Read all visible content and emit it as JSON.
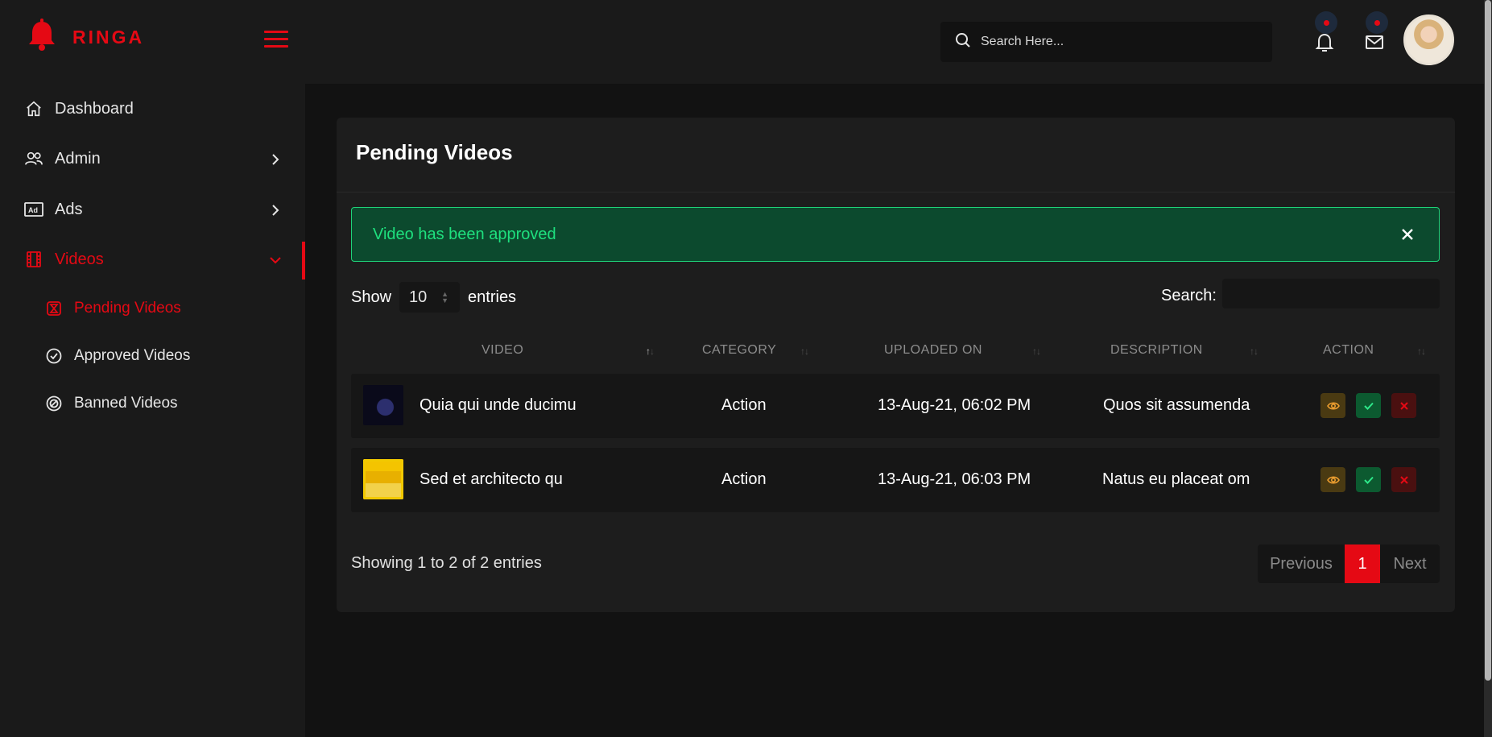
{
  "brand": {
    "name": "RINGA",
    "color": "#e50914"
  },
  "sidebar": {
    "items": [
      {
        "label": "Dashboard",
        "icon": "home-icon"
      },
      {
        "label": "Admin",
        "icon": "users-icon"
      },
      {
        "label": "Ads",
        "icon": "ad-icon"
      },
      {
        "label": "Videos",
        "icon": "film-icon"
      }
    ],
    "sub_items": [
      {
        "label": "Pending Videos",
        "icon": "pending-icon"
      },
      {
        "label": "Approved Videos",
        "icon": "check-circle-icon"
      },
      {
        "label": "Banned Videos",
        "icon": "ban-icon"
      }
    ]
  },
  "header": {
    "search_placeholder": "Search Here..."
  },
  "page": {
    "title": "Pending Videos",
    "alert": "Video has been approved",
    "show_label": "Show",
    "entries_count": "10",
    "entries_label": "entries",
    "search_label": "Search:"
  },
  "table": {
    "headers": [
      "VIDEO",
      "CATEGORY",
      "UPLOADED ON",
      "DESCRIPTION",
      "ACTION"
    ],
    "rows": [
      {
        "title": "Quia qui unde ducimu",
        "category": "Action",
        "uploaded": "13-Aug-21, 06:02 PM",
        "description": "Quos sit assumenda"
      },
      {
        "title": "Sed et architecto qu",
        "category": "Action",
        "uploaded": "13-Aug-21, 06:03 PM",
        "description": "Natus eu placeat om"
      }
    ]
  },
  "footer": {
    "info": "Showing 1 to 2 of 2 entries",
    "prev": "Previous",
    "page": "1",
    "next": "Next"
  },
  "colors": {
    "accent": "#e50914",
    "success": "#1ee07e",
    "background": "#121212"
  }
}
